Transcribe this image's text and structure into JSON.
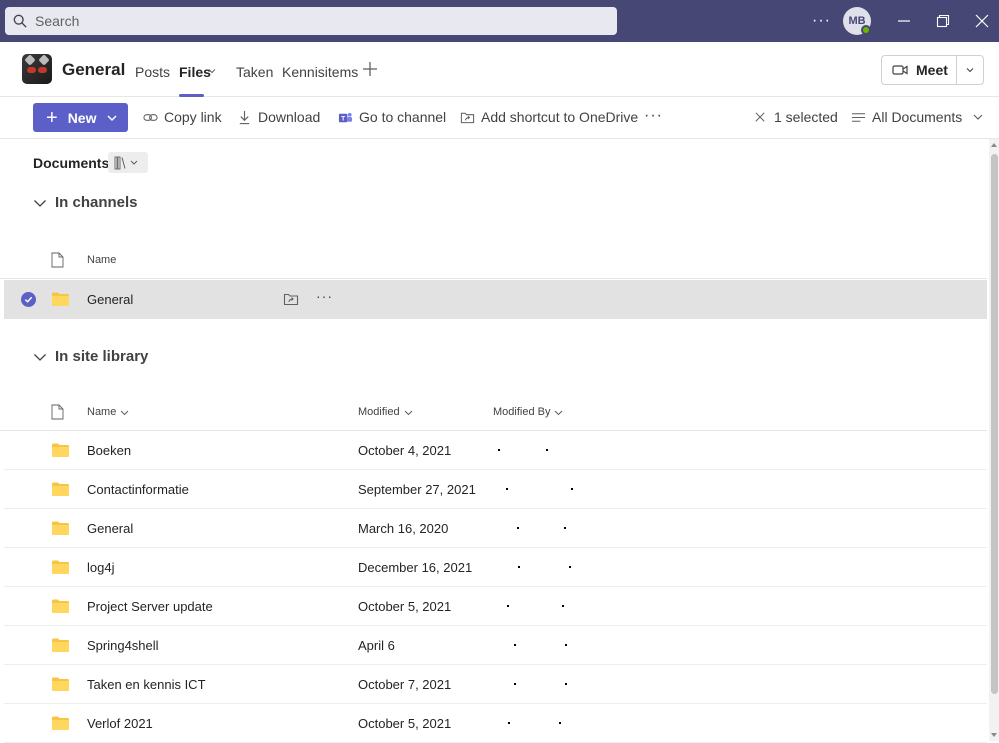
{
  "search": {
    "placeholder": "Search"
  },
  "titlebar": {
    "more_label": "···",
    "avatar_initials": "MB",
    "presence_color": "#6bb700",
    "accent": "#464775"
  },
  "channel": {
    "title": "General",
    "tabs": [
      {
        "label": "Posts",
        "active": false
      },
      {
        "label": "Files",
        "active": true
      },
      {
        "label": "Taken",
        "active": false
      },
      {
        "label": "Kennisitems",
        "active": false
      }
    ],
    "meet_label": "Meet"
  },
  "toolbar": {
    "new_label": "New",
    "copy_link_label": "Copy link",
    "download_label": "Download",
    "go_to_channel_label": "Go to channel",
    "add_shortcut_label": "Add shortcut to OneDrive",
    "more_label": "···",
    "selected_label": "1 selected",
    "view_label": "All Documents",
    "brand_color": "#5b5fc7"
  },
  "breadcrumb": {
    "label": "Documents"
  },
  "channels_section": {
    "title": "In channels",
    "column_name": "Name",
    "rows": [
      {
        "name": "General",
        "selected": true
      }
    ],
    "row_more": "···"
  },
  "library_section": {
    "title": "In site library",
    "columns": {
      "name": "Name",
      "modified": "Modified",
      "modified_by": "Modified By"
    },
    "rows": [
      {
        "name": "Boeken",
        "modified": "October 4, 2021"
      },
      {
        "name": "Contactinformatie",
        "modified": "September 27, 2021"
      },
      {
        "name": "General",
        "modified": "March 16, 2020"
      },
      {
        "name": "log4j",
        "modified": "December 16, 2021"
      },
      {
        "name": "Project Server update",
        "modified": "October 5, 2021"
      },
      {
        "name": "Spring4shell",
        "modified": "April 6"
      },
      {
        "name": "Taken en kennis ICT",
        "modified": "October 7, 2021"
      },
      {
        "name": "Verlof 2021",
        "modified": "October 5, 2021"
      }
    ]
  },
  "icons": {
    "search": "search-icon",
    "folder": "folder-icon",
    "file": "file-icon",
    "check": "check-icon",
    "video": "video-camera-icon",
    "link": "link-icon",
    "download": "download-icon",
    "teams": "teams-icon",
    "shortcut": "shortcut-icon",
    "close": "close-icon",
    "view": "list-view-icon",
    "library": "library-icon",
    "chevron": "chevron-down-icon",
    "plus": "plus-icon"
  },
  "folder_color": "#f8c444"
}
